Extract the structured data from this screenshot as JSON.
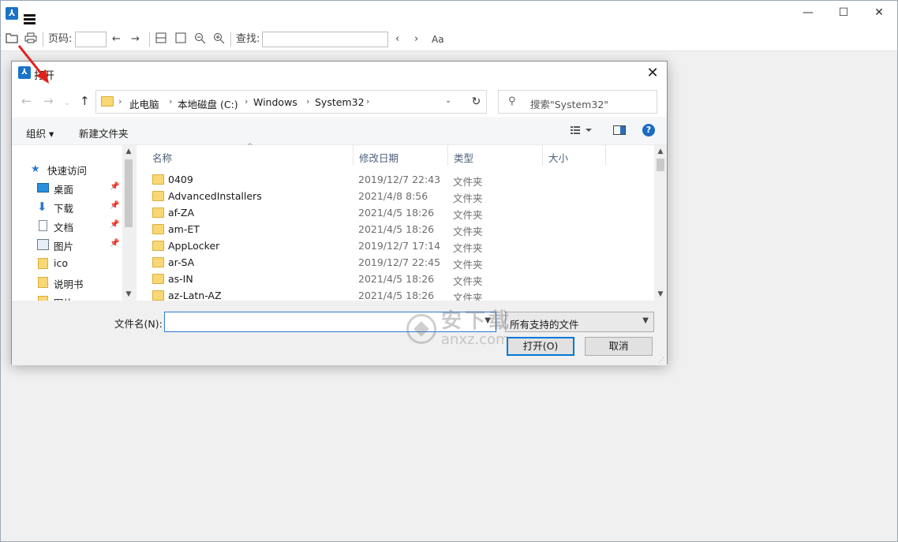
{
  "app": {
    "toolbar": {
      "page_label": "页码:",
      "find_label": "查找:",
      "page_value": "",
      "find_value": ""
    }
  },
  "dialog": {
    "title": "打开",
    "breadcrumb": [
      "此电脑",
      "本地磁盘 (C:)",
      "Windows",
      "System32"
    ],
    "search_placeholder": "搜索\"System32\"",
    "commands": {
      "organize": "组织 ▾",
      "new_folder": "新建文件夹",
      "help": "?"
    },
    "nav_items": [
      {
        "label": "快速访问"
      },
      {
        "label": "桌面"
      },
      {
        "label": "下载"
      },
      {
        "label": "文档"
      },
      {
        "label": "图片"
      },
      {
        "label": "ico"
      },
      {
        "label": "说明书"
      },
      {
        "label": "图片"
      }
    ],
    "columns": {
      "name": "名称",
      "date": "修改日期",
      "type": "类型",
      "size": "大小"
    },
    "files": [
      {
        "name": "0409",
        "date": "2019/12/7 22:43",
        "type": "文件夹"
      },
      {
        "name": "AdvancedInstallers",
        "date": "2021/4/8 8:56",
        "type": "文件夹"
      },
      {
        "name": "af-ZA",
        "date": "2021/4/5 18:26",
        "type": "文件夹"
      },
      {
        "name": "am-ET",
        "date": "2021/4/5 18:26",
        "type": "文件夹"
      },
      {
        "name": "AppLocker",
        "date": "2019/12/7 17:14",
        "type": "文件夹"
      },
      {
        "name": "ar-SA",
        "date": "2019/12/7 22:45",
        "type": "文件夹"
      },
      {
        "name": "as-IN",
        "date": "2021/4/5 18:26",
        "type": "文件夹"
      },
      {
        "name": "az-Latn-AZ",
        "date": "2021/4/5 18:26",
        "type": "文件夹"
      }
    ],
    "filename_label": "文件名(N):",
    "filename_value": "",
    "filter": "所有支持的文件",
    "open_button": "打开(O)",
    "cancel_button": "取消"
  },
  "watermark": {
    "text_cn": "安下载",
    "text_en": "anxz.com"
  },
  "colors": {
    "accent": "#0078d7",
    "folder": "#f8d775",
    "annotation_arrow": "#e0201b"
  }
}
